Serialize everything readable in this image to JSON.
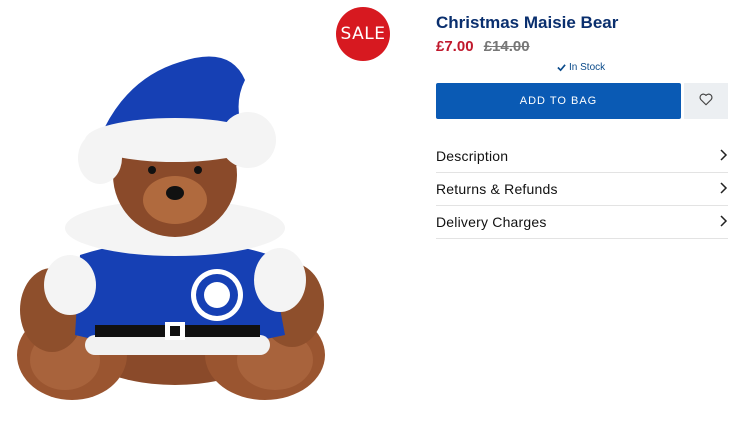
{
  "badge": {
    "sale": "SALE"
  },
  "product": {
    "title": "Christmas Maisie Bear",
    "price_now": "£7.00",
    "price_was": "£14.00",
    "stock": "In Stock"
  },
  "actions": {
    "add_to_bag": "ADD TO BAG"
  },
  "accordion": [
    {
      "label": "Description"
    },
    {
      "label": "Returns & Refunds"
    },
    {
      "label": "Delivery Charges"
    }
  ],
  "colors": {
    "brand_blue": "#0a5ab4",
    "title_blue": "#0a2f6e",
    "sale_red": "#d71920",
    "price_red": "#c0182c"
  },
  "icons": [
    "check-icon",
    "heart-icon",
    "chevron-right-icon"
  ]
}
